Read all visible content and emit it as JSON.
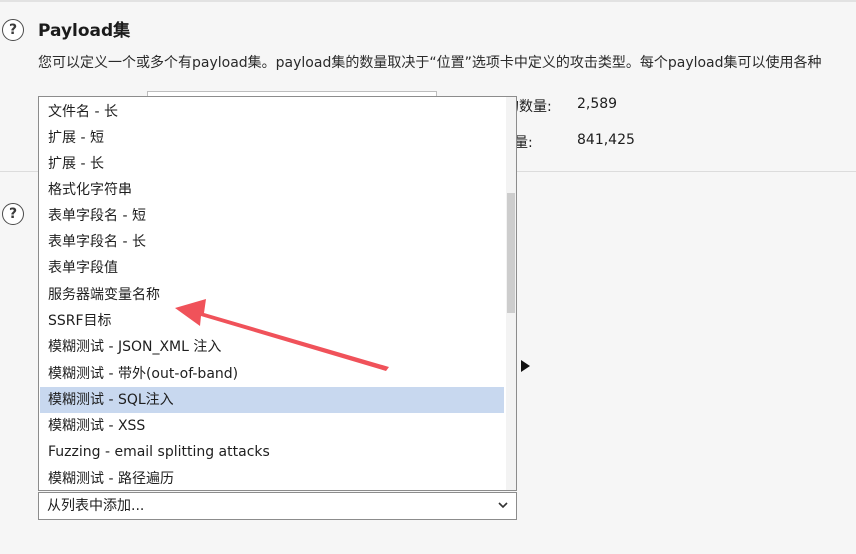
{
  "section": {
    "title": "Payload集",
    "description": "您可以定义一个或多个有payload集。payload集的数量取决于“位置”选项卡中定义的攻击类型。每个payload集可以使用各种"
  },
  "stats": {
    "label1": "的数量:",
    "value1": "2,589",
    "label2": "量:",
    "value2": "841,425"
  },
  "dropdown": {
    "items": [
      "文件名 - 长",
      "扩展 - 短",
      "扩展 - 长",
      "格式化字符串",
      "表单字段名 - 短",
      "表单字段名 - 长",
      "表单字段值",
      "服务器端变量名称",
      "SSRF目标",
      "模糊测试 - JSON_XML 注入",
      "模糊测试 - 带外(out-of-band)",
      "模糊测试 -  SQL注入",
      "模糊测试 -  XSS",
      "Fuzzing - email splitting attacks",
      "模糊测试 - 路径遍历"
    ],
    "selected_index": 11
  },
  "combo": {
    "label": "从列表中添加..."
  },
  "annotation": {
    "color": "#f0525a"
  },
  "icons": {
    "help": "help-icon",
    "chevron": "chevron-down-icon",
    "expand": "triangle-right-icon"
  }
}
